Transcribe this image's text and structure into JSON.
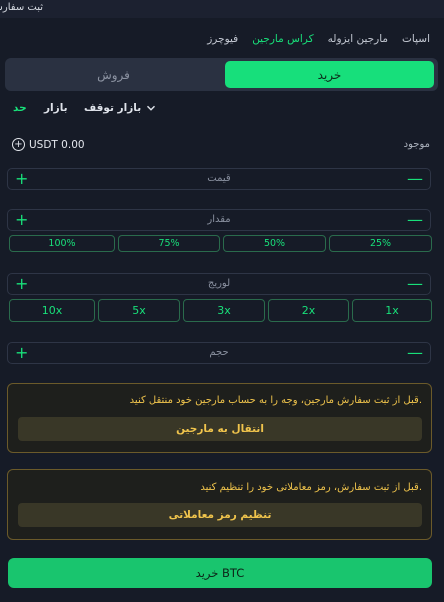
{
  "header": {
    "title": "ثبت سفارش"
  },
  "market_tabs": [
    "اسپات",
    "مارجین ایزوله",
    "کراس مارجین",
    "فیوچرز"
  ],
  "market_tab_active": "کراس مارجین",
  "side": {
    "buy": "خرید",
    "sell": "فروش",
    "active": "buy"
  },
  "order_types": {
    "limit": "حد",
    "market": "بازار",
    "stop": "بازار توقف",
    "chevron_icon": "chevron-down-icon"
  },
  "available": {
    "label": "موجود",
    "value": "USDT 0.00",
    "icon": "plus-circle-icon"
  },
  "fields": {
    "price": "قیمت",
    "amount": "مقدار",
    "leverage": "لوریج",
    "volume": "حجم"
  },
  "percent_chips": [
    "25%",
    "50%",
    "75%",
    "100%"
  ],
  "leverage_chips": [
    "1x",
    "2x",
    "3x",
    "5x",
    "10x"
  ],
  "notice_margin": {
    "message": "قبل از ثبت سفارش مارجین، وجه را به حساب مارجین خود منتقل کنید.",
    "button": "انتقال به مارجین"
  },
  "notice_pin": {
    "message": "قبل از ثبت سفارش، رمز معاملاتی خود را تنظیم کنید.",
    "button": "تنظیم رمز معاملاتی"
  },
  "submit": {
    "label": "خرید BTC"
  },
  "colors": {
    "accent": "#18e07a",
    "warning": "#f0c44c",
    "background": "#161b27"
  }
}
